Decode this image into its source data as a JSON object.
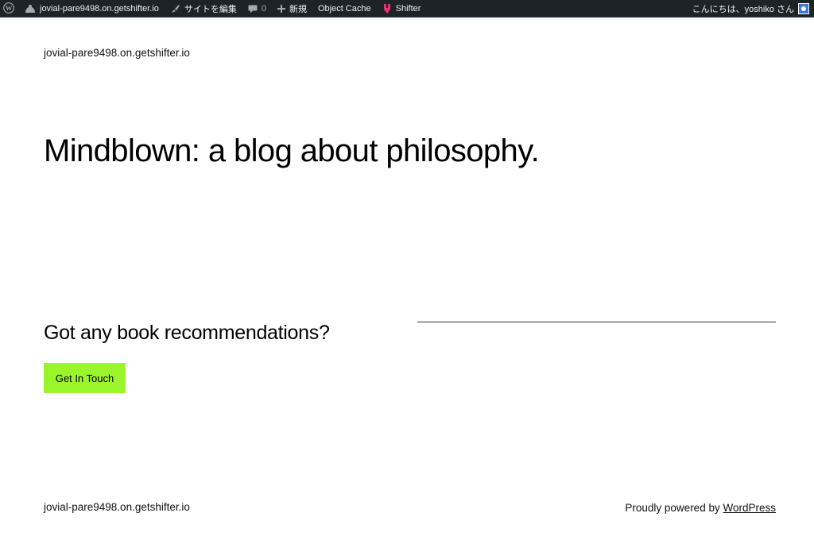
{
  "admin_bar": {
    "site_name": "jovial-pare9498.on.getshifter.io",
    "edit_site": "サイトを編集",
    "comments_count": "0",
    "new_label": "新規",
    "object_cache": "Object Cache",
    "shifter": "Shifter",
    "greeting": "こんにちは、yoshiko さん"
  },
  "header": {
    "site_title": "jovial-pare9498.on.getshifter.io"
  },
  "main": {
    "hero_heading": "Mindblown: a blog about philosophy.",
    "cta_heading": "Got any book recommendations?",
    "cta_button": "Get In Touch"
  },
  "footer": {
    "site_title": "jovial-pare9498.on.getshifter.io",
    "credit_prefix": "Proudly powered by ",
    "credit_link": "WordPress"
  },
  "colors": {
    "admin_bar_bg": "#1d2327",
    "button_bg": "#9bf52b",
    "text": "#000000"
  }
}
